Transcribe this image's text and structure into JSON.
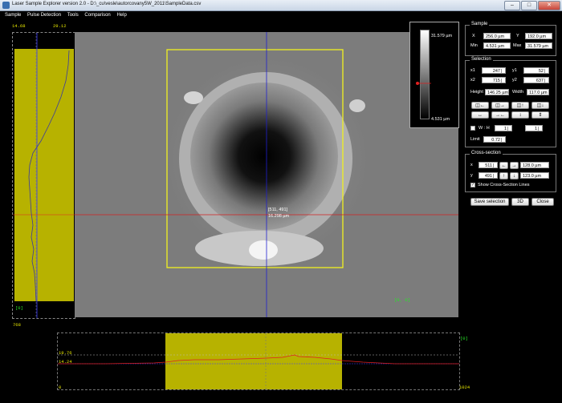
{
  "window": {
    "title": "Laser Sample Explorer version 2.0 - D:\\_cu\\vesle\\autorcovany5W_2011\\SampleData.csv"
  },
  "menu": [
    "Sample",
    "Pulse Detection",
    "Tools",
    "Comparison",
    "Help"
  ],
  "vprofile": {
    "min_label": "14.68",
    "max_label": "29.12",
    "index_label": "[0]",
    "end_label": "768"
  },
  "hprofile": {
    "val_high": "19.76",
    "val_low": "14.24",
    "start_label": "0",
    "end_label": "1024",
    "index_label": "[0]"
  },
  "image": {
    "coord_label": "[511, 491]",
    "value_label": "16.298 µm",
    "origin_label": "[0, 0]"
  },
  "legend": {
    "max": "31.579 µm",
    "min": "4.531 µm"
  },
  "sample": {
    "title": "Sample",
    "x_label": "X",
    "x_value": "256.0 µm",
    "y_label": "Y",
    "y_value": "192.0 µm",
    "min_label": "Min",
    "min_value": "4.531 µm",
    "max_label": "Max",
    "max_value": "31.579 µm"
  },
  "selection": {
    "title": "Selection",
    "x1_label": "x1",
    "x1": "247",
    "y1_label": "y1",
    "y1": "52",
    "x2_label": "x2",
    "x2": "715",
    "y2_label": "y2",
    "y2": "637",
    "height_label": "Height",
    "height": "146.25 µm",
    "width_label": "Width",
    "width": "117.0 µm",
    "wh_label": "W : H",
    "wh_w": "1",
    "wh_h": "1",
    "limit_label": "Limit",
    "limit": "0.72"
  },
  "crosssection": {
    "title": "Cross-section",
    "x_label": "x",
    "x": "511",
    "x_um": "128.0 µm",
    "y_label": "y",
    "y": "491",
    "y_um": "123.0 µm",
    "show_label": "Show Cross-Section Lines"
  },
  "buttons": {
    "save": "Save selection",
    "three_d": "3D",
    "close": "Close"
  }
}
